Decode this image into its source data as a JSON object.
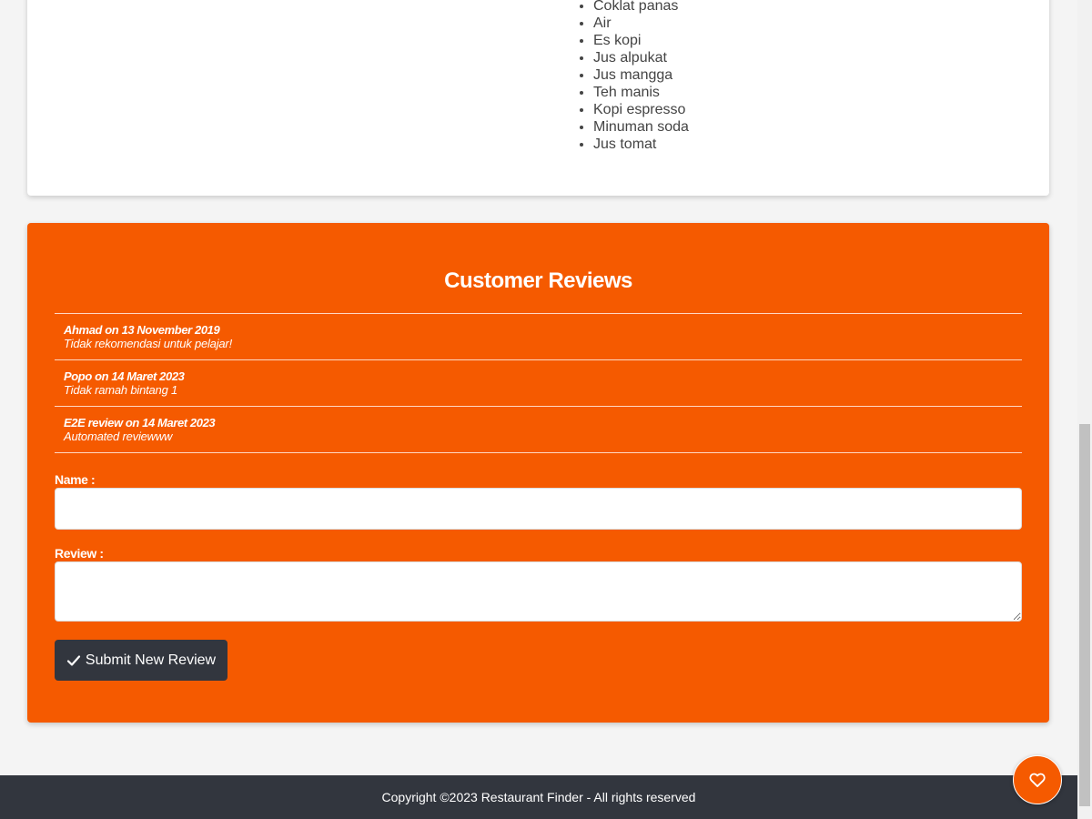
{
  "menu": {
    "drinks": [
      "Coklat panas",
      "Air",
      "Es kopi",
      "Jus alpukat",
      "Jus mangga",
      "Teh manis",
      "Kopi espresso",
      "Minuman soda",
      "Jus tomat"
    ]
  },
  "reviews": {
    "title": "Customer Reviews",
    "items": [
      {
        "header": "Ahmad on 13 November 2019",
        "text": "Tidak rekomendasi untuk pelajar!"
      },
      {
        "header": "Popo on 14 Maret 2023",
        "text": "Tidak ramah bintang 1"
      },
      {
        "header": "E2E review on 14 Maret 2023",
        "text": "Automated reviewww"
      }
    ]
  },
  "form": {
    "name_label": "Name :",
    "name_value": "",
    "review_label": "Review :",
    "review_value": "",
    "submit_label": "Submit New Review",
    "submit_icon": "check-icon"
  },
  "footer": {
    "copyright": "Copyright ©2023 Restaurant Finder - All rights reserved"
  },
  "fab": {
    "icon": "heart-icon"
  },
  "colors": {
    "accent": "#f55a00",
    "dark": "#32363e",
    "background": "#f4f4f4"
  }
}
